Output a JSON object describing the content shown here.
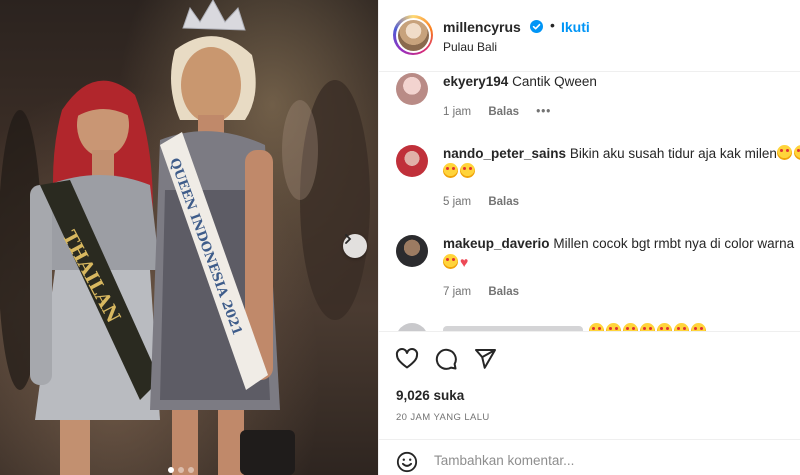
{
  "post": {
    "username": "millencyrus",
    "follow_label": "Ikuti",
    "separator": "•",
    "location": "Pulau Bali"
  },
  "photo": {
    "sash_left": "THAILAN",
    "sash_right": "QUEEN INDONESIA 2021",
    "carousel_dot_count": 3,
    "carousel_active_index": 0
  },
  "comments": [
    {
      "user": "ekyery194",
      "text": "Cantik Qween",
      "emoji_count": 0,
      "time": "1 jam",
      "reply": "Balas",
      "more": "•••"
    },
    {
      "user": "nando_peter_sains",
      "text": "Bikin aku susah tidur aja kak milen",
      "emoji_count": 4,
      "time": "5 jam",
      "reply": "Balas"
    },
    {
      "user": "makeup_daverio",
      "text": "Millen cocok bgt rmbt nya di color warna",
      "emoji_count": 1,
      "heart": "♥",
      "time": "7 jam",
      "reply": "Balas"
    }
  ],
  "actions": {
    "likes": "9,026 suka",
    "timestamp": "20 JAM YANG LALU",
    "comment_placeholder": "Tambahkan komentar..."
  },
  "colors": {
    "accent": "#0095f6",
    "verified": "#0095f6",
    "heart": "#ed4956",
    "muted": "#737373"
  },
  "icons": [
    "chevron-right-icon",
    "verified-badge-icon",
    "heart-icon",
    "comment-icon",
    "share-icon",
    "emoji-icon"
  ]
}
